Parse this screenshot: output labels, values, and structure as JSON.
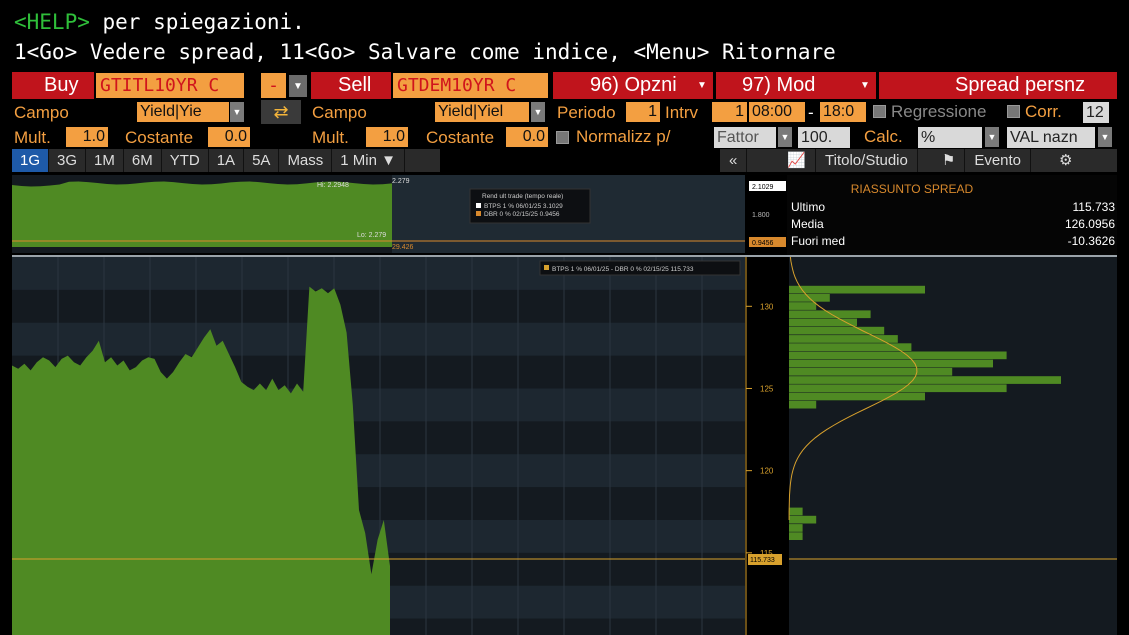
{
  "command": {
    "help_key": "<HELP>",
    "help_text": " per spiegazioni.",
    "line2": "1<Go> Vedere spread, 11<Go> Salvare come indice, <Menu> Ritornare"
  },
  "toolbar": {
    "buy_label": "Buy",
    "buy_ticker": "GTITL10YR C",
    "buy_sign": "-",
    "sell_label": "Sell",
    "sell_ticker": "GTDEM10YR C",
    "options_label": "96) Opzni",
    "mod_label": "97) Mod",
    "spread_title": "Spread persnz"
  },
  "params": {
    "campo_label": "Campo",
    "buy_field": "Yield|Yie",
    "campo2_label": "Campo",
    "sell_field": "Yield|Yiel",
    "periodo_label": "Periodo",
    "periodo_value": "1",
    "intrv_label": "Intrv",
    "intrv_value": "1",
    "time_start": "08:00",
    "time_sep": "-",
    "time_end": "18:0",
    "regressione_label": "Regressione",
    "corr_label": "Corr.",
    "corr_value": "12",
    "mult_label": "Mult.",
    "mult_value": "1.0",
    "costante_label": "Costante",
    "costante_value": "0.0",
    "mult2_label": "Mult.",
    "mult2_value": "1.0",
    "costante2_label": "Costante",
    "costante2_value": "0.0",
    "normalizz_label": "Normalizz p/",
    "fattor_label": "Fattor",
    "fattor_value": "100.",
    "calc_label": "Calc.",
    "calc_value": "%",
    "valuta_label": "VAL nazn"
  },
  "ranges": [
    "1G",
    "3G",
    "1M",
    "6M",
    "YTD",
    "1A",
    "5A",
    "Mass",
    "1 Min ▼"
  ],
  "right_tools": {
    "collapse": "«",
    "titolo": "Titolo/Studio",
    "evento": "Evento",
    "settings": "⚙"
  },
  "top_chart": {
    "hi_label": "Hi: 2.2948",
    "lo_label": "Lo: 2.279",
    "tick_top": "2.279",
    "tick_bottom": "29.426",
    "legend_title": "Rend ult trade (tempo reale)",
    "legend_1": "BTPS 1 % 06/01/25 3.1029",
    "legend_2": "DBR 0 % 02/15/25 0.9456",
    "axis_top_box": "2.1029",
    "axis_mid": "1.800",
    "axis_bottom_box": "0.9456"
  },
  "main_chart": {
    "legend": "BTPS 1 % 06/01/25 - DBR 0 % 02/15/25 115.733",
    "y_ticks": [
      "130",
      "125",
      "120",
      "115"
    ],
    "last_box": "115.733"
  },
  "summary": {
    "title": "RIASSUNTO SPREAD",
    "ultimo_label": "Ultimo",
    "ultimo_value": "115.733",
    "media_label": "Media",
    "media_value": "126.0956",
    "fuori_label": "Fuori med",
    "fuori_value": "-10.3626"
  },
  "colors": {
    "accent_orange": "#f39f41",
    "toolbar_red": "#c0141c",
    "series_green": "#4f8a23",
    "help_green": "#2fbf3a"
  },
  "chart_data": {
    "type": "area",
    "series": [
      {
        "name": "BTPS 1 % 06/01/25 - DBR 0 % 02/15/25",
        "values": [
          126.4,
          126.2,
          126.5,
          126.1,
          126.6,
          126.9,
          126.7,
          126.3,
          126.8,
          127.0,
          126.6,
          126.4,
          126.9,
          127.3,
          127.9,
          126.6,
          126.9,
          126.4,
          126.7,
          126.1,
          126.3,
          126.7,
          126.9,
          126.8,
          126.0,
          125.6,
          126.0,
          126.6,
          127.1,
          126.9,
          127.5,
          128.1,
          128.6,
          127.6,
          127.9,
          127.1,
          126.3,
          125.4,
          125.1,
          124.9,
          125.3,
          124.9,
          125.6,
          124.9,
          125.2,
          124.7,
          125.3,
          124.8,
          131.2,
          130.9,
          131.1,
          130.8,
          131.1,
          130.1,
          128.4,
          124.0,
          117.6,
          116.2,
          113.7,
          115.8,
          117.0,
          114.2
        ]
      }
    ],
    "ylim": [
      110,
      133
    ],
    "y_ticks": [
      115,
      120,
      125,
      130
    ],
    "last_value": 115.733,
    "mean": 126.0956,
    "histogram": {
      "bins": [
        131,
        130.5,
        130,
        129.5,
        129,
        128.5,
        128,
        127.5,
        127,
        126.5,
        126,
        125.5,
        125,
        124.5,
        124,
        117.5,
        117,
        116.5,
        116
      ],
      "counts": [
        10,
        3,
        2,
        6,
        5,
        7,
        8,
        9,
        16,
        15,
        12,
        20,
        16,
        10,
        2,
        1,
        2,
        1,
        1
      ]
    }
  }
}
